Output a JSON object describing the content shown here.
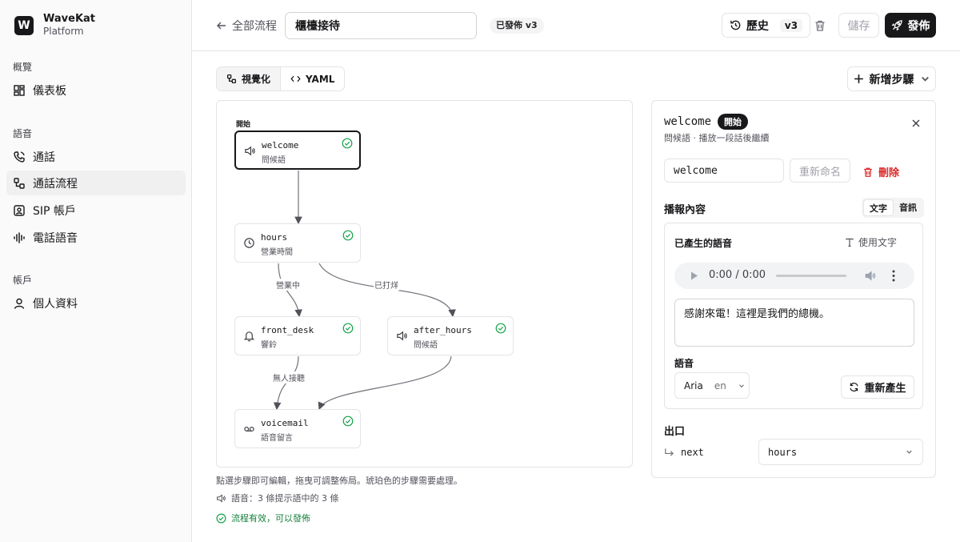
{
  "brand": {
    "name": "WaveKat",
    "sub": "Platform",
    "logo_letter": "W"
  },
  "sidebar": {
    "groups": [
      {
        "label": "概覽"
      },
      {
        "label": "語音"
      },
      {
        "label": "帳戶"
      }
    ],
    "items": [
      {
        "label": "儀表板",
        "icon": "dashboard-icon"
      },
      {
        "label": "通話",
        "icon": "phone-icon"
      },
      {
        "label": "通話流程",
        "icon": "flow-icon",
        "active": true
      },
      {
        "label": "SIP 帳戶",
        "icon": "sip-account-icon"
      },
      {
        "label": "電話語音",
        "icon": "waveform-icon"
      },
      {
        "label": "個人資料",
        "icon": "user-icon"
      }
    ]
  },
  "header": {
    "back_label": "全部流程",
    "flow_name": "櫃檯接待",
    "status": "已發佈 v3",
    "history_label": "歷史",
    "history_version": "v3",
    "save_label": "儲存",
    "publish_label": "發佈"
  },
  "view_tabs": {
    "visual": "視覺化",
    "yaml": "YAML"
  },
  "add_step_label": "新增步驟",
  "canvas": {
    "start_label": "開始",
    "nodes": [
      {
        "id": "welcome",
        "type": "問候語",
        "icon": "speaker-icon",
        "selected": true
      },
      {
        "id": "hours",
        "type": "營業時間",
        "icon": "clock-icon"
      },
      {
        "id": "front_desk",
        "type": "響鈴",
        "icon": "bell-icon"
      },
      {
        "id": "after_hours",
        "type": "問候語",
        "icon": "speaker-icon"
      },
      {
        "id": "voicemail",
        "type": "語音留言",
        "icon": "voicemail-icon"
      }
    ],
    "edges": [
      {
        "from": "welcome",
        "to": "hours",
        "label": ""
      },
      {
        "from": "hours",
        "to": "front_desk",
        "label": "營業中"
      },
      {
        "from": "hours",
        "to": "after_hours",
        "label": "已打烊"
      },
      {
        "from": "front_desk",
        "to": "voicemail",
        "label": "無人接聽"
      },
      {
        "from": "after_hours",
        "to": "voicemail",
        "label": ""
      }
    ]
  },
  "footer_hints": {
    "edit": "點選步驟即可編輯，拖曳可調整佈局。琥珀色的步驟需要處理。",
    "voice": "語音：3 條提示語中的 3 條",
    "valid": "流程有效，可以發佈"
  },
  "panel": {
    "step_id": "welcome",
    "start_badge": "開始",
    "subtitle": "問候語 · 播放一段話後繼續",
    "name_value": "welcome",
    "rename_label": "重新命名",
    "delete_label": "刪除",
    "content_title": "播報內容",
    "mode_text": "文字",
    "mode_audio": "音訊",
    "generated_title": "已產生的語音",
    "use_text_label": "使用文字",
    "audio_time": "0:00 / 0:00",
    "prompt_text": "感謝來電！這裡是我們的總機。",
    "voice_title": "語音",
    "voice_name": "Aria",
    "voice_lang": "en",
    "regenerate_label": "重新產生",
    "exits_title": "出口",
    "exit_key": "next",
    "exit_target": "hours"
  },
  "colors": {
    "accent": "#18181b",
    "success": "#16a34a",
    "danger": "#dc2626"
  }
}
